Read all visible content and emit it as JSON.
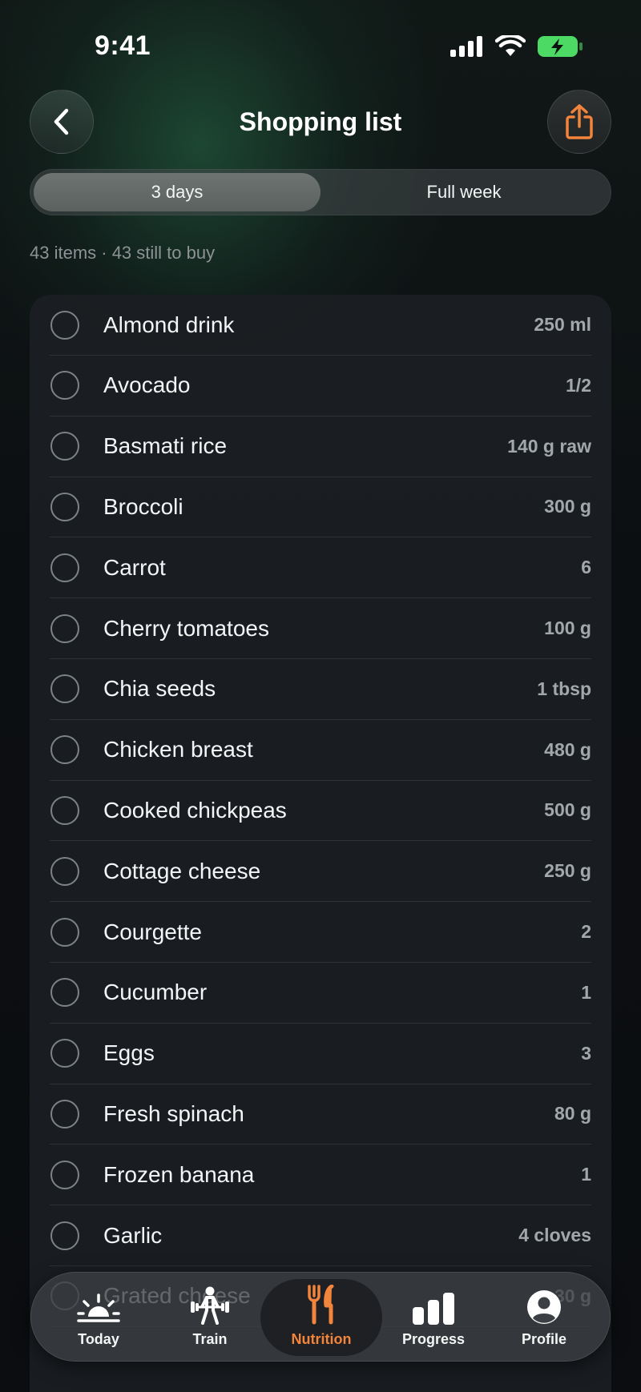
{
  "status_bar": {
    "time": "9:41"
  },
  "header": {
    "title": "Shopping list"
  },
  "segmented": {
    "options": [
      "3 days",
      "Full week"
    ],
    "selected": "3 days"
  },
  "summary": "43 items · 43 still to buy",
  "items": [
    {
      "name": "Almond drink",
      "qty": "250 ml"
    },
    {
      "name": "Avocado",
      "qty": "1/2"
    },
    {
      "name": "Basmati rice",
      "qty": "140 g raw"
    },
    {
      "name": "Broccoli",
      "qty": "300 g"
    },
    {
      "name": "Carrot",
      "qty": "6"
    },
    {
      "name": "Cherry tomatoes",
      "qty": "100 g"
    },
    {
      "name": "Chia seeds",
      "qty": "1 tbsp"
    },
    {
      "name": "Chicken breast",
      "qty": "480 g"
    },
    {
      "name": "Cooked chickpeas",
      "qty": "500 g"
    },
    {
      "name": "Cottage cheese",
      "qty": "250 g"
    },
    {
      "name": "Courgette",
      "qty": "2"
    },
    {
      "name": "Cucumber",
      "qty": "1"
    },
    {
      "name": "Eggs",
      "qty": "3"
    },
    {
      "name": "Fresh spinach",
      "qty": "80 g"
    },
    {
      "name": "Frozen banana",
      "qty": "1"
    },
    {
      "name": "Garlic",
      "qty": "4 cloves"
    },
    {
      "name": "Grated cheese",
      "qty": "30 g"
    }
  ],
  "tabbar": {
    "tabs": [
      {
        "label": "Today",
        "icon": "sunrise-icon"
      },
      {
        "label": "Train",
        "icon": "weightlifter-icon"
      },
      {
        "label": "Nutrition",
        "icon": "fork-knife-icon"
      },
      {
        "label": "Progress",
        "icon": "bar-chart-icon"
      },
      {
        "label": "Profile",
        "icon": "person-circle-icon"
      }
    ],
    "active": "Nutrition"
  },
  "colors": {
    "accent": "#f2843c",
    "battery": "#4cd964"
  }
}
